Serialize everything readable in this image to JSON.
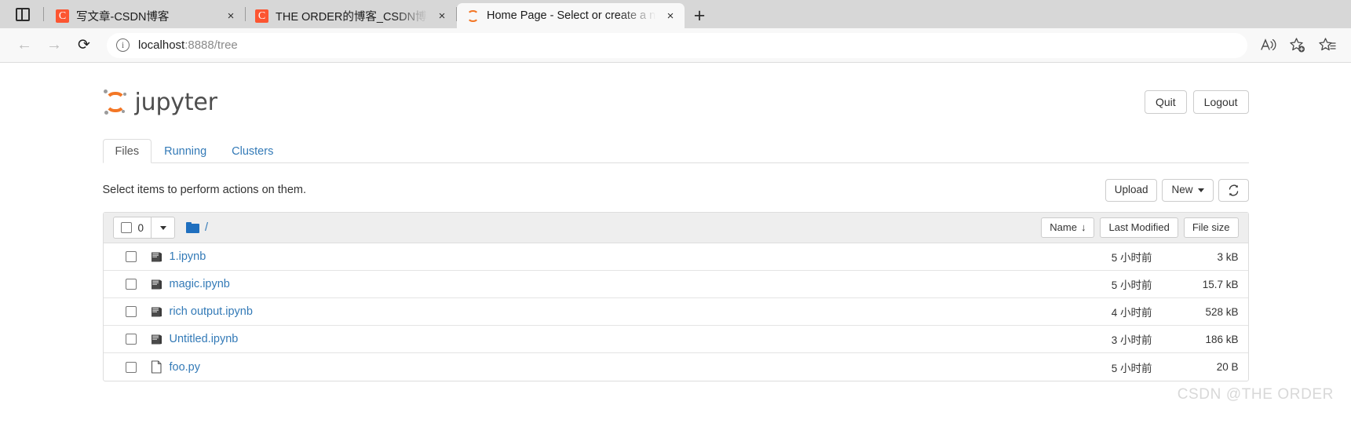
{
  "browser": {
    "tab_tools_icon": "split-pane-icon",
    "tabs": [
      {
        "favicon": "csdn-icon",
        "favicon_letter": "C",
        "title": "写文章-CSDN博客",
        "close_label": "×",
        "active": false
      },
      {
        "favicon": "csdn-icon",
        "favicon_letter": "C",
        "title": "THE ORDER的博客_CSDN博客-R",
        "close_label": "×",
        "active": false
      },
      {
        "favicon": "jupyter-icon",
        "favicon_letter": "",
        "title": "Home Page - Select or create a n",
        "close_label": "×",
        "active": true
      }
    ],
    "new_tab_label": "+",
    "nav": {
      "back": "←",
      "forward": "→",
      "reload": "⟳"
    },
    "omnibox": {
      "info_icon": "info-icon",
      "url_host": "localhost",
      "url_rest": ":8888/tree"
    },
    "toolbar_icons": [
      "read-aloud-icon",
      "add-favorite-icon",
      "collections-icon"
    ]
  },
  "jupyter": {
    "logo_text": "jupyter",
    "header_buttons": [
      {
        "label": "Quit"
      },
      {
        "label": "Logout"
      }
    ],
    "tabs": [
      {
        "label": "Files",
        "active": true
      },
      {
        "label": "Running",
        "active": false
      },
      {
        "label": "Clusters",
        "active": false
      }
    ],
    "action_text": "Select items to perform actions on them.",
    "action_buttons": {
      "upload": "Upload",
      "new": "New",
      "refresh_icon": "refresh-icon"
    },
    "filelist": {
      "select_count": "0",
      "breadcrumb": "/",
      "folder_icon": "folder-icon",
      "sort_buttons": [
        {
          "label": "Name",
          "arrow": "↓"
        },
        {
          "label": "Last Modified",
          "arrow": ""
        },
        {
          "label": "File size",
          "arrow": ""
        }
      ],
      "rows": [
        {
          "icon": "notebook-icon",
          "name": "1.ipynb",
          "modified": "5 小时前",
          "size": "3 kB"
        },
        {
          "icon": "notebook-icon",
          "name": "magic.ipynb",
          "modified": "5 小时前",
          "size": "15.7 kB"
        },
        {
          "icon": "notebook-icon",
          "name": "rich output.ipynb",
          "modified": "4 小时前",
          "size": "528 kB"
        },
        {
          "icon": "notebook-icon",
          "name": "Untitled.ipynb",
          "modified": "3 小时前",
          "size": "186 kB"
        },
        {
          "icon": "file-icon",
          "name": "foo.py",
          "modified": "5 小时前",
          "size": "20 B"
        }
      ]
    }
  },
  "watermark": "CSDN @THE ORDER",
  "colors": {
    "jupyter_orange": "#f37726",
    "link_blue": "#337ab7",
    "csdn_red": "#fc5531",
    "folder_blue": "#1f6fbf"
  }
}
